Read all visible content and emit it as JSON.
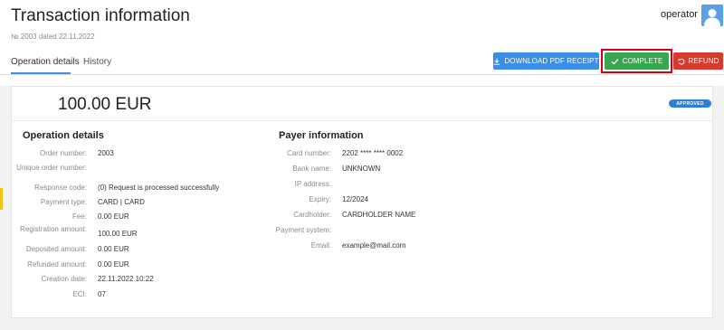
{
  "header": {
    "title": "Transaction information",
    "subtitle": "№ 2003 dated 22.11.2022",
    "user_name": "operator",
    "avatar_icon": "user-avatar-icon"
  },
  "tabs": [
    {
      "label": "Operation details",
      "active": true
    },
    {
      "label": "History",
      "active": false
    }
  ],
  "actions": {
    "download_label": "DOWNLOAD PDF RECEIPT",
    "complete_label": "COMPLETE",
    "refund_label": "REFUND",
    "colors": {
      "download": "#3a8ee6",
      "complete": "#3aa551",
      "refund": "#d63b2f",
      "highlight": "#d4001a"
    }
  },
  "summary": {
    "amount": "100.00 EUR",
    "status": "APPROVED",
    "status_color": "#2f7fd8"
  },
  "operation_details": {
    "title": "Operation details",
    "fields": [
      {
        "label": "Order number:",
        "value": "2003"
      },
      {
        "label": "Unique order number:",
        "value": ""
      },
      {
        "label": "Response code:",
        "value": "(0) Request is processed successfully"
      },
      {
        "label": "Payment type:",
        "value": "CARD | CARD"
      },
      {
        "label": "Fee:",
        "value": "0.00 EUR"
      },
      {
        "label": "Registration amount:",
        "value": "100.00 EUR"
      },
      {
        "label": "Deposited amount:",
        "value": "0.00 EUR"
      },
      {
        "label": "Refunded amount:",
        "value": "0.00 EUR"
      },
      {
        "label": "Creation date:",
        "value": "22.11.2022 10:22"
      },
      {
        "label": "ECI:",
        "value": "07"
      }
    ]
  },
  "payer_information": {
    "title": "Payer information",
    "fields": [
      {
        "label": "Card number:",
        "value": "2202 **** **** 0002"
      },
      {
        "label": "Bank name:",
        "value": "UNKNOWN"
      },
      {
        "label": "IP address:",
        "value": ""
      },
      {
        "label": "Expiry:",
        "value": "12/2024"
      },
      {
        "label": "Cardholder:",
        "value": "CARDHOLDER NAME"
      },
      {
        "label": "Payment system:",
        "value": ""
      },
      {
        "label": "Email:",
        "value": "example@mail.com"
      }
    ]
  }
}
